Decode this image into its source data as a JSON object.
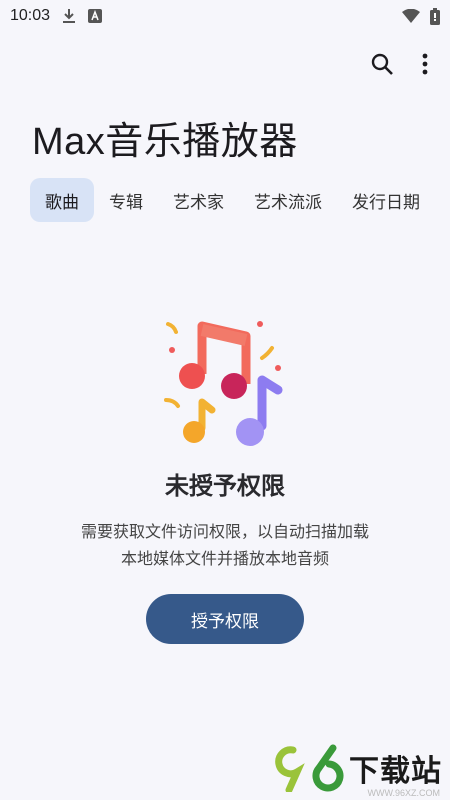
{
  "status_bar": {
    "time": "10:03",
    "icons": [
      "download-icon",
      "a-icon",
      "wifi-icon",
      "battery-icon"
    ]
  },
  "toolbar": {
    "icons": [
      "search-icon",
      "more-vert-icon"
    ]
  },
  "app": {
    "title": "Max音乐播放器"
  },
  "tabs": [
    {
      "label": "歌曲",
      "active": true
    },
    {
      "label": "专辑"
    },
    {
      "label": "艺术家"
    },
    {
      "label": "艺术流派"
    },
    {
      "label": "发行日期"
    }
  ],
  "empty_state": {
    "illustration_icon": "music-notes-icon",
    "title": "未授予权限",
    "description_line1": "需要获取文件访问权限，以自动扫描加载",
    "description_line2": "本地媒体文件并播放本地音频",
    "button_label": "授予权限"
  },
  "watermark": {
    "brand": "下载站",
    "url": "WWW.96XZ.COM"
  },
  "colors": {
    "background": "#f6f6fb",
    "tab_active_bg": "#d8e3f6",
    "primary_button": "#36598a"
  }
}
